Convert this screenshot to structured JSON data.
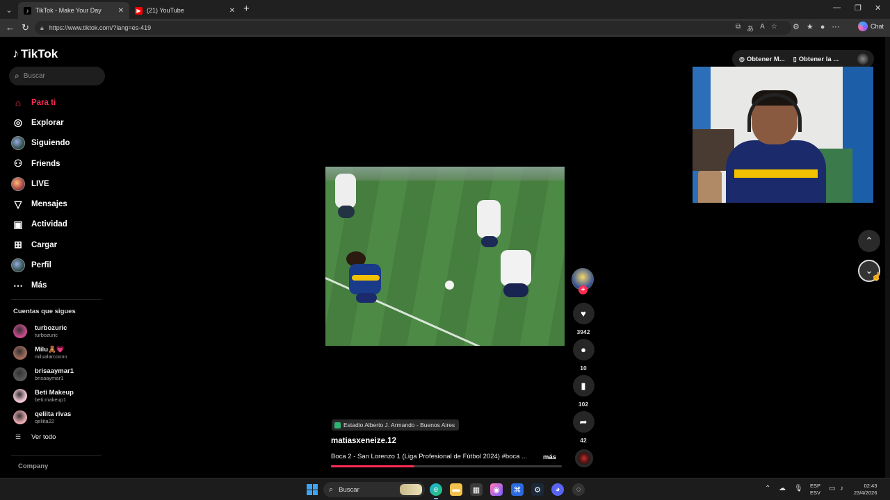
{
  "browser": {
    "tabs": [
      {
        "label": "TikTok - Make Your Day",
        "active": true
      },
      {
        "label": "(21) YouTube",
        "active": false
      }
    ],
    "url": "https://www.tiktok.com/?lang=es-419",
    "copilot_label": "Chat"
  },
  "app": {
    "brand": "TikTok",
    "search_placeholder": "Buscar",
    "nav": [
      {
        "label": "Para ti",
        "icon": "home-icon",
        "active": true
      },
      {
        "label": "Explorar",
        "icon": "compass-icon"
      },
      {
        "label": "Siguiendo",
        "icon": "following-avatar-icon"
      },
      {
        "label": "Friends",
        "icon": "friends-icon"
      },
      {
        "label": "LIVE",
        "icon": "live-avatar-icon"
      },
      {
        "label": "Mensajes",
        "icon": "send-icon"
      },
      {
        "label": "Actividad",
        "icon": "activity-icon"
      },
      {
        "label": "Cargar",
        "icon": "upload-icon"
      },
      {
        "label": "Perfil",
        "icon": "profile-avatar-icon"
      },
      {
        "label": "Más",
        "icon": "more-icon"
      }
    ],
    "following_title": "Cuentas que sigues",
    "following": [
      {
        "name": "turbozuric",
        "handle": "turbozuric",
        "color": "#c44a8a"
      },
      {
        "name": "Milu🧸💗",
        "handle": "milualarconnn",
        "color": "#a06b5a"
      },
      {
        "name": "brisaaymar1",
        "handle": "brisaaymar1",
        "color": "#555555"
      },
      {
        "name": "Beti Makeup",
        "handle": "beti.makeup1",
        "color": "#f1c4d3"
      },
      {
        "name": "qeliita rivas",
        "handle": "qeliita22",
        "color": "#e8a8b0"
      }
    ],
    "see_all": "Ver todo",
    "company": "Company",
    "top_actions": [
      "Obtener M...",
      "Obtener la ..."
    ]
  },
  "post": {
    "location": "Estadio Alberto J. Armando - Buenos Aires",
    "username": "matiasxeneize.12",
    "description": "Boca 2 - San Lorenzo 1 (Liga Profesional de Fútbol 2024) #boca ...",
    "more_label": "más",
    "likes": "3942",
    "comments": "10",
    "saves": "102",
    "shares": "42",
    "progress": 0.36
  },
  "taskbar": {
    "search": "Buscar",
    "lang_line1": "ESP",
    "lang_line2": "ESV",
    "time": "02:43",
    "date": "23/4/2026"
  }
}
